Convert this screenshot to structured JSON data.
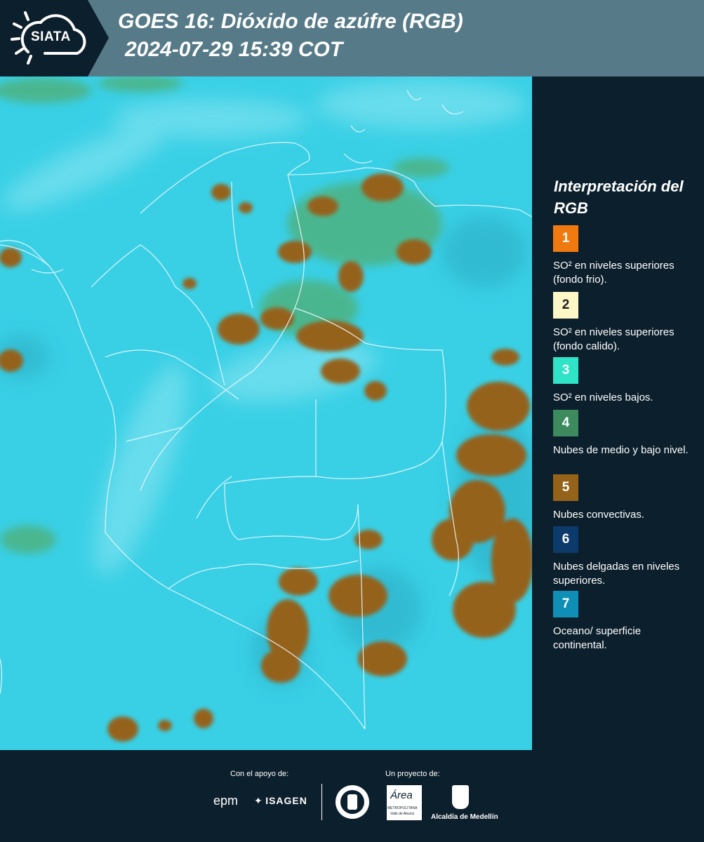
{
  "header": {
    "logo_text": "SIATA",
    "title_line1": "GOES 16: Dióxido de azúfre (RGB)",
    "title_line2": "2024-07-29 15:39 COT"
  },
  "legend": {
    "title": "Interpretación del RGB",
    "items": [
      {
        "num": "1",
        "color": "#f07a10",
        "text": "SO² en niveles superiores (fondo frio)."
      },
      {
        "num": "2",
        "color": "#fdf6c6",
        "text": "SO² en niveles superiores (fondo calido)."
      },
      {
        "num": "3",
        "color": "#2fe3c6",
        "text": "SO² en niveles bajos."
      },
      {
        "num": "4",
        "color": "#3c8a5e",
        "text": "Nubes de medio y bajo nivel."
      },
      {
        "num": "5",
        "color": "#95621a",
        "text": "Nubes convectivas."
      },
      {
        "num": "6",
        "color": "#0c3a6a",
        "text": "Nubes delgadas en niveles superiores."
      },
      {
        "num": "7",
        "color": "#0f8fb6",
        "text": "Oceano/ superficie continental."
      }
    ]
  },
  "footer": {
    "support_label": "Con el apoyo de:",
    "project_label": "Un proyecto de:",
    "sponsor_epm": "epm",
    "sponsor_isagen": "ISAGEN",
    "sponsor_area_script": "Área",
    "sponsor_area_line1": "METROPOLITANA",
    "sponsor_area_line2": "Valle de Aburrá",
    "sponsor_alcaldia": "Alcaldía de Medellín"
  },
  "colors": {
    "header_bg": "#567a88",
    "panel_bg": "#0c1f2c",
    "map_base": "#39d0e6",
    "cloud_convective": "#95621a",
    "cloud_low": "#4fb07a"
  }
}
